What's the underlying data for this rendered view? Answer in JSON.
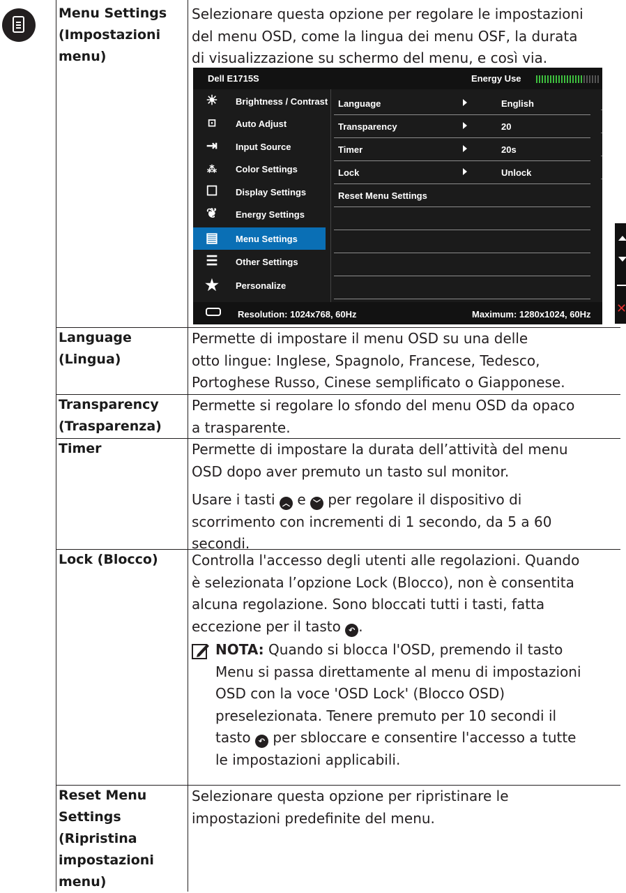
{
  "section": {
    "title": "Menu Settings (Impostazioni menu)",
    "title_lines": [
      "Menu Settings",
      "(Impostazioni",
      "menu)"
    ],
    "description_lines": [
      "Selezionare questa opzione per regolare le impostazioni",
      "del menu OSD, come la lingua dei menu OSF, la durata",
      "di visualizzazione su schermo del menu, e così via."
    ]
  },
  "osd": {
    "model": "Dell E1715S",
    "energy_label": "Energy Use",
    "menu_items": [
      {
        "label": "Brightness / Contrast",
        "icon": "brightness-icon"
      },
      {
        "label": "Auto Adjust",
        "icon": "auto-adjust-icon"
      },
      {
        "label": "Input Source",
        "icon": "input-source-icon"
      },
      {
        "label": "Color Settings",
        "icon": "color-settings-icon"
      },
      {
        "label": "Display Settings",
        "icon": "display-settings-icon"
      },
      {
        "label": "Energy Settings",
        "icon": "energy-settings-icon"
      },
      {
        "label": "Menu Settings",
        "icon": "menu-settings-icon",
        "selected": true
      },
      {
        "label": "Other Settings",
        "icon": "other-settings-icon"
      },
      {
        "label": "Personalize",
        "icon": "star-icon"
      }
    ],
    "submenu": [
      {
        "label": "Language",
        "value": "English"
      },
      {
        "label": "Transparency",
        "value": "20"
      },
      {
        "label": "Timer",
        "value": "20s"
      },
      {
        "label": "Lock",
        "value": "Unlock"
      },
      {
        "label": "Reset Menu Settings",
        "value": ""
      }
    ],
    "resolution": "Resolution: 1024x768, 60Hz",
    "maximum": "Maximum: 1280x1024, 60Hz",
    "selected_color": "#0a6fb5"
  },
  "rows": [
    {
      "label_lines": [
        "Language (Lingua)"
      ],
      "desc_lines": [
        "Permette di impostare il menu OSD su una delle",
        "otto lingue: Inglese, Spagnolo, Francese, Tedesco,",
        "Portoghese Russo, Cinese semplificato o Giapponese."
      ]
    },
    {
      "label_lines": [
        "Transparency",
        "(Trasparenza)"
      ],
      "desc_lines": [
        "Permette si regolare lo sfondo del menu OSD da opaco",
        "a trasparente."
      ]
    },
    {
      "label_lines": [
        "Timer"
      ],
      "desc_lines": [
        "Permette di impostare la durata dell’attività del menu",
        "OSD dopo aver premuto un tasto sul monitor."
      ],
      "extra": {
        "before": "Usare i tasti",
        "mid": "e",
        "after": "per regolare il dispositivo di",
        "lines": [
          "scorrimento con incrementi di 1 secondo, da 5 a 60",
          "secondi."
        ]
      }
    },
    {
      "label_lines": [
        "Lock (Blocco)"
      ],
      "desc_lines": [
        "Controlla l'accesso degli utenti alle regolazioni. Quando",
        "è selezionata l’opzione Lock (Blocco), non è consentita",
        "alcuna regolazione. Sono bloccati tutti i tasti, fatta"
      ],
      "last_line": "eccezione per il tasto"
    },
    {
      "label_lines": [
        "Reset Menu",
        "Settings",
        "(Ripristina",
        "impostazioni",
        "menu)"
      ],
      "desc_lines": [
        "Selezionare questa opzione per ripristinare le",
        "impostazioni predefinite del menu."
      ]
    }
  ],
  "note": {
    "label": "NOTA:",
    "first": "Quando si blocca l'OSD, premendo il tasto",
    "lines": [
      "Menu si passa direttamente al menu di impostazioni",
      "OSD con la voce 'OSD Lock' (Blocco OSD)",
      "preselezionata. Tenere premuto per 10 secondi il"
    ],
    "last_before": "tasto",
    "last_after": "per sbloccare e consentire l'accesso a tutte",
    "final": "le impostazioni applicabili."
  },
  "icons": {
    "up": "up-button-icon",
    "down": "down-button-icon",
    "back": "back-button-icon",
    "pen": "note-pen-icon"
  }
}
